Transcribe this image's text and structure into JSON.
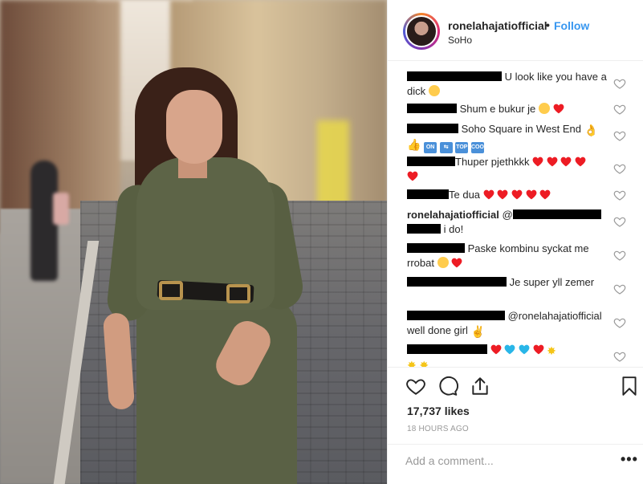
{
  "post": {
    "username": "ronelahajatiofficial",
    "dot": "•",
    "follow_label": "Follow",
    "location": "SoHo"
  },
  "comments": [
    {
      "text": " U look like you have a dick",
      "emoji": [
        "face"
      ]
    },
    {
      "text": " Shum e bukur je",
      "emoji": [
        "face",
        "heart"
      ]
    },
    {
      "text": " Soho Square in West End",
      "emoji": [
        "hand"
      ],
      "line2_emoji": [
        "thumb",
        "box:ON",
        "box:⇆",
        "box:TOP",
        "box:COOL"
      ]
    },
    {
      "text": "Thuper pjethkkk",
      "emoji": [
        "heart",
        "heart",
        "heart",
        "heart"
      ],
      "line2_emoji": [
        "heart"
      ]
    },
    {
      "text": "Te dua ",
      "emoji": [
        "heart",
        "heart",
        "heart",
        "heart",
        "heart"
      ]
    },
    {
      "user": "ronelahajatiofficial",
      "text": " @",
      "line2": "i do!"
    },
    {
      "text": " Paske kombinu syckat me rrobat",
      "emoji": [
        "face",
        "heart"
      ]
    },
    {
      "text": " Je super yll zemer"
    },
    {
      "text": " @ronelahajatiofficial well done girl",
      "emoji": [
        "hand"
      ]
    },
    {
      "text": " ",
      "emoji": [
        "heart",
        "blueheart",
        "blueheart",
        "heart",
        "star"
      ],
      "line2_emoji": [
        "star",
        "star"
      ]
    }
  ],
  "likes_label": "17,737 likes",
  "timestamp": "18 HOURS AGO",
  "add_comment_placeholder": "Add a comment...",
  "more_label": "•••",
  "colors": {
    "follow_blue": "#3897f0",
    "heart_red": "#ed1c24",
    "text": "#262626",
    "muted": "#999999"
  },
  "icons": [
    "heart-icon",
    "comment-icon",
    "share-icon",
    "bookmark-icon",
    "like-comment-icon"
  ]
}
